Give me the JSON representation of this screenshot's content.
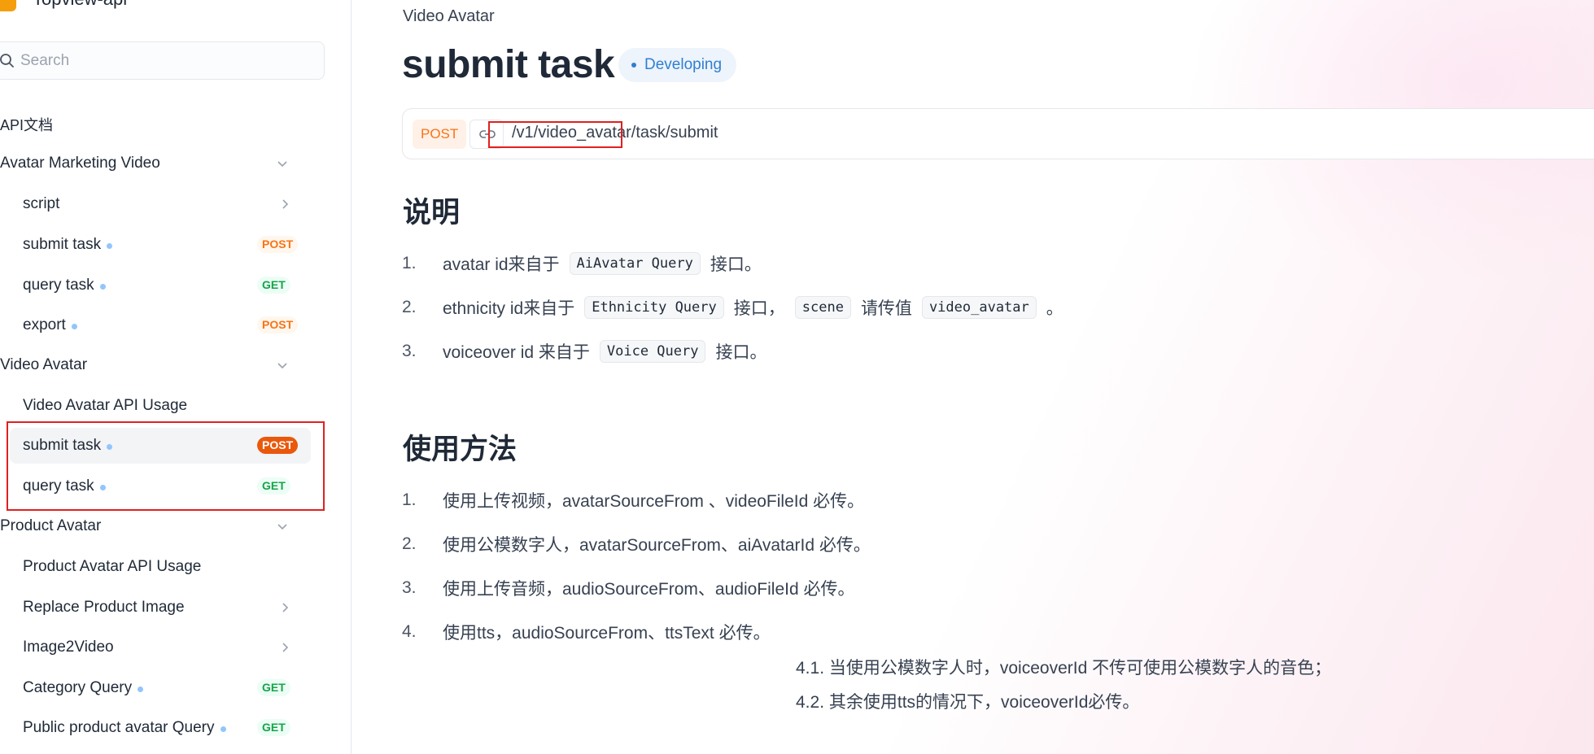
{
  "sidebar": {
    "app_name": "Topview-api",
    "search_placeholder": "Search",
    "section_title": "API文档",
    "groups": [
      {
        "label": "Avatar Marketing Video"
      },
      {
        "label": "Video Avatar"
      },
      {
        "label": "Product Avatar"
      }
    ],
    "items": [
      {
        "label": "script"
      },
      {
        "label": "submit task",
        "method": "POST"
      },
      {
        "label": "query task",
        "method": "GET"
      },
      {
        "label": "export",
        "method": "POST"
      },
      {
        "label": "Video Avatar API Usage"
      },
      {
        "label": "submit task",
        "method": "POST"
      },
      {
        "label": "query task",
        "method": "GET"
      },
      {
        "label": "Product Avatar API Usage"
      },
      {
        "label": "Replace Product Image"
      },
      {
        "label": "Image2Video"
      },
      {
        "label": "Category Query",
        "method": "GET"
      },
      {
        "label": "Public product avatar Query",
        "method": "GET"
      }
    ]
  },
  "main": {
    "breadcrumb": "Video Avatar",
    "title": "submit task",
    "status": "Developing",
    "endpoint": {
      "method": "POST",
      "path": "/v1/video_avatar/task/submit"
    },
    "section1": {
      "heading": "说明",
      "items": [
        {
          "num": "1.",
          "pre": "avatar id来自于",
          "code": "AiAvatar Query",
          "post": "接口。"
        },
        {
          "num": "2.",
          "pre": "ethnicity id来自于",
          "code": "Ethnicity Query",
          "mid": "接口，",
          "code2": "scene",
          "mid2": "请传值",
          "code3": "video_avatar",
          "post": "。"
        },
        {
          "num": "3.",
          "pre": "voiceover id 来自于",
          "code": "Voice Query",
          "post": "接口。"
        }
      ]
    },
    "section2": {
      "heading": "使用方法",
      "items": [
        {
          "num": "1.",
          "text": "使用上传视频，avatarSourceFrom 、videoFileId 必传。"
        },
        {
          "num": "2.",
          "text": "使用公模数字人，avatarSourceFrom、aiAvatarId 必传。"
        },
        {
          "num": "3.",
          "text": "使用上传音频，audioSourceFrom、audioFileId 必传。"
        },
        {
          "num": "4.",
          "text": "使用tts，audioSourceFrom、ttsText 必传。"
        }
      ],
      "subitems": [
        "4.1. 当使用公模数字人时，voiceoverId 不传可使用公模数字人的音色；",
        "4.2. 其余使用tts的情况下，voiceoverId必传。"
      ]
    }
  },
  "colors": {
    "accent_blue": "#2f7fd1",
    "post_orange": "#f97316",
    "get_green": "#16a34a",
    "highlight_red": "#e02020"
  }
}
